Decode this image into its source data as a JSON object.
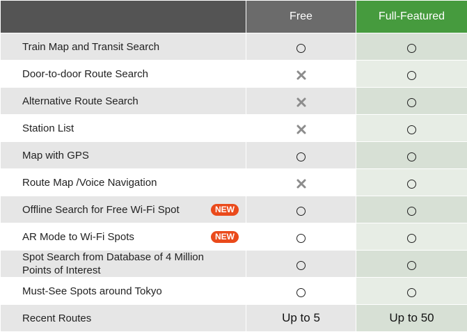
{
  "header": {
    "free_label": "Free",
    "full_label": "Full-Featured"
  },
  "rows": [
    {
      "feature": "Train Map and Transit Search",
      "badge": "",
      "free": "circle",
      "full": "circle"
    },
    {
      "feature": "Door-to-door Route Search",
      "badge": "",
      "free": "cross",
      "full": "circle"
    },
    {
      "feature": "Alternative Route Search",
      "badge": "",
      "free": "cross",
      "full": "circle"
    },
    {
      "feature": "Station List",
      "badge": "",
      "free": "cross",
      "full": "circle"
    },
    {
      "feature": "Map with GPS",
      "badge": "",
      "free": "circle",
      "full": "circle"
    },
    {
      "feature": "Route Map /Voice Navigation",
      "badge": "",
      "free": "cross",
      "full": "circle"
    },
    {
      "feature": "Offline Search for Free Wi-Fi Spot",
      "badge": "NEW",
      "free": "circle",
      "full": "circle"
    },
    {
      "feature": "AR Mode to Wi-Fi Spots",
      "badge": "NEW",
      "free": "circle",
      "full": "circle"
    },
    {
      "feature": "Spot Search from Database of 4 Million Points of Interest",
      "badge": "",
      "free": "circle",
      "full": "circle"
    },
    {
      "feature": "Must-See Spots around Tokyo",
      "badge": "",
      "free": "circle",
      "full": "circle"
    },
    {
      "feature": "Recent Routes",
      "badge": "",
      "free": "Up to 5",
      "full": "Up to 50"
    }
  ],
  "colors": {
    "header_dark": "#545454",
    "header_free": "#6b6b6b",
    "header_full": "#469b3e",
    "badge_new": "#ea4a1b"
  },
  "icons": {
    "available": "circle-icon",
    "unavailable": "cross-icon"
  }
}
